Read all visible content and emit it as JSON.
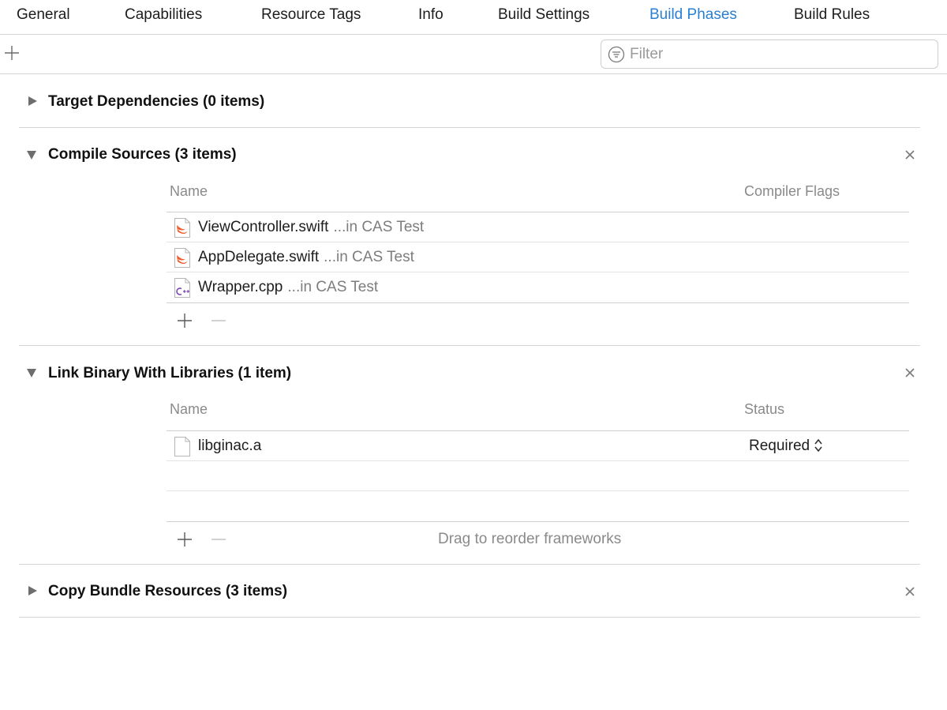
{
  "tabs": [
    {
      "label": "General"
    },
    {
      "label": "Capabilities"
    },
    {
      "label": "Resource Tags"
    },
    {
      "label": "Info"
    },
    {
      "label": "Build Settings"
    },
    {
      "label": "Build Phases"
    },
    {
      "label": "Build Rules"
    }
  ],
  "active_tab": "Build Phases",
  "accent_color": "#2a7fd4",
  "filter": {
    "placeholder": "Filter",
    "value": ""
  },
  "phases": {
    "target_dependencies": {
      "title": "Target Dependencies (0 items)",
      "expanded": false
    },
    "compile_sources": {
      "title": "Compile Sources (3 items)",
      "expanded": true,
      "columns": {
        "name": "Name",
        "flags": "Compiler Flags"
      },
      "files": [
        {
          "name": "ViewController.swift",
          "location": "...in CAS Test",
          "icon": "swift-file-icon"
        },
        {
          "name": "AppDelegate.swift",
          "location": "...in CAS Test",
          "icon": "swift-file-icon"
        },
        {
          "name": "Wrapper.cpp",
          "location": "...in CAS Test",
          "icon": "cpp-file-icon"
        }
      ]
    },
    "link_binary": {
      "title": "Link Binary With Libraries (1 item)",
      "expanded": true,
      "columns": {
        "name": "Name",
        "status": "Status"
      },
      "libraries": [
        {
          "name": "libginac.a",
          "status": "Required",
          "icon": "blank-file-icon"
        }
      ],
      "hint": "Drag to reorder frameworks"
    },
    "copy_bundle": {
      "title": "Copy Bundle Resources (3 items)",
      "expanded": false
    }
  }
}
